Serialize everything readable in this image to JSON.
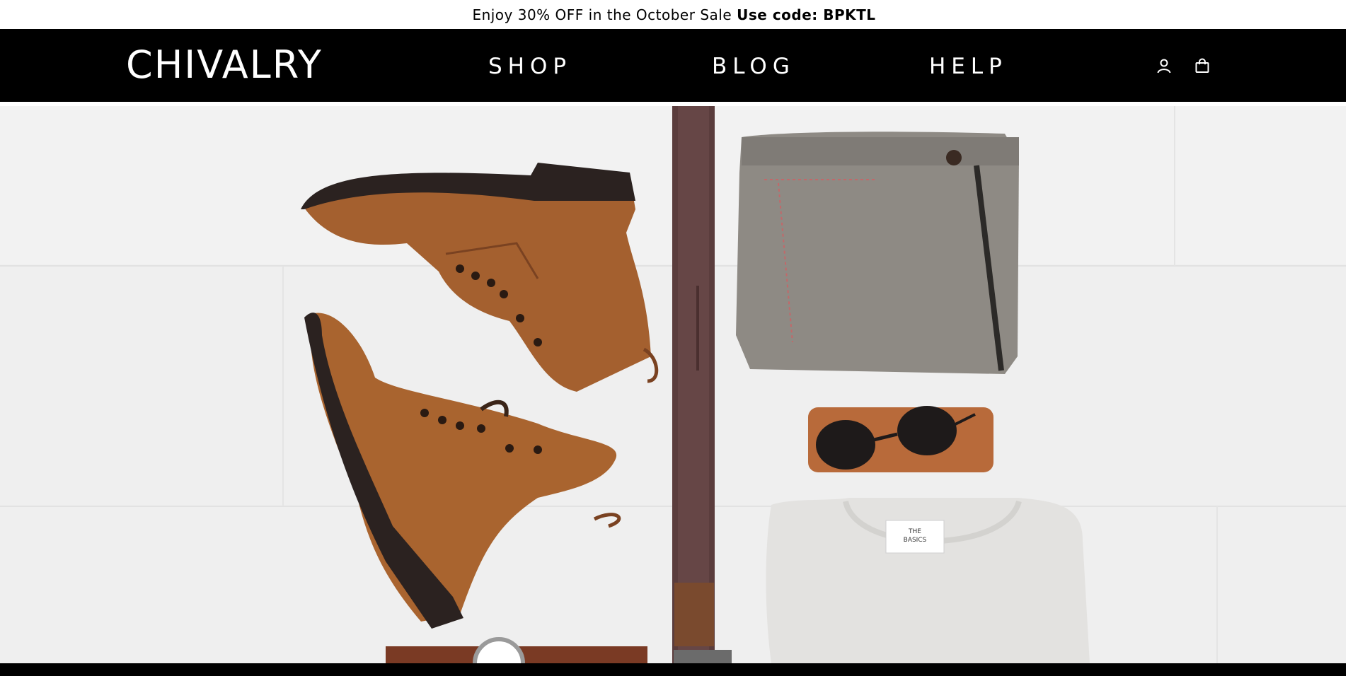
{
  "announcement": {
    "text": "Enjoy 30% OFF in the October Sale",
    "code": "Use code: BPKTL"
  },
  "header": {
    "logo": "CHIVALRY",
    "nav": [
      {
        "label": "SHOP"
      },
      {
        "label": "BLOG"
      },
      {
        "label": "HELP"
      }
    ],
    "icons": [
      "account-icon",
      "cart-icon"
    ]
  },
  "hero": {
    "image": "flat-lay-menswear",
    "tshirt_label_line1": "THE",
    "tshirt_label_line2": "BASICS"
  },
  "colors": {
    "header_bg": "#000000",
    "hero_bg": "#efefef",
    "leather": "#9a5a2f",
    "belt": "#5b3d3d"
  }
}
